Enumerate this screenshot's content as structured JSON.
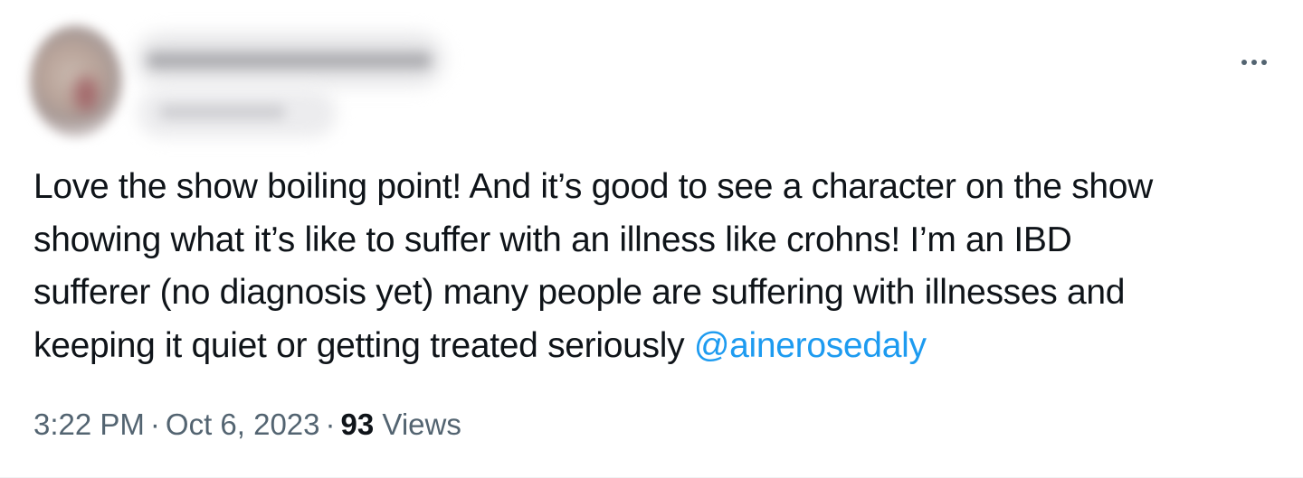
{
  "tweet": {
    "author": {
      "avatar_icon": "blurred-avatar",
      "display_name": "",
      "handle": ""
    },
    "more_icon": "more-horizontal-icon",
    "text_lines": [
      "Love the show boiling point! And it’s good to see a character on the show",
      "showing what it’s like to suffer with an illness like crohns! I’m an IBD",
      "sufferer (no diagnosis yet) many people are suffering with illnesses and",
      "keeping it quiet or getting treated seriously "
    ],
    "mention": "@ainerosedaly",
    "time": "3:22 PM",
    "separator": "·",
    "date": "Oct 6, 2023",
    "views_count": "93",
    "views_label": "Views",
    "colors": {
      "text": "#0f1419",
      "secondary": "#536471",
      "link": "#1d9bf0"
    }
  }
}
